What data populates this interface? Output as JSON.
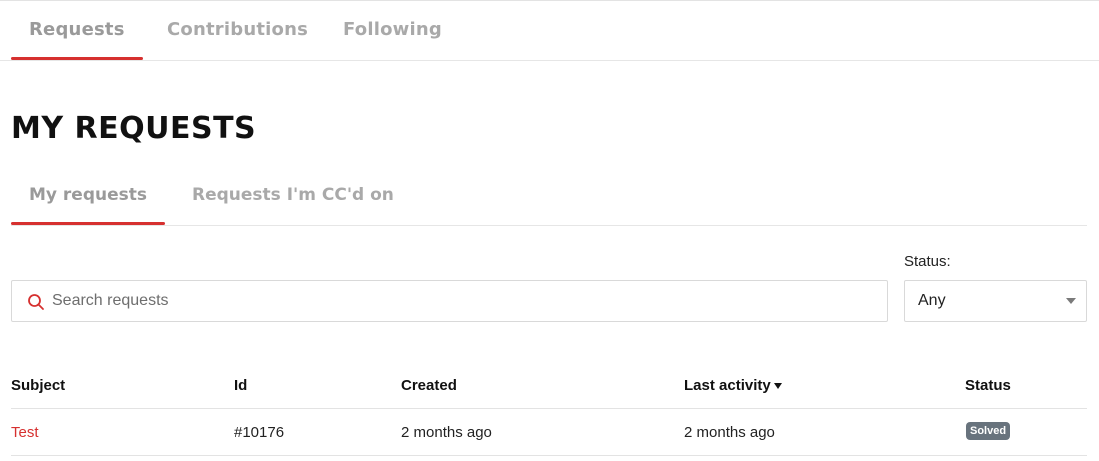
{
  "top_tabs": [
    {
      "label": "Requests",
      "active": true
    },
    {
      "label": "Contributions",
      "active": false
    },
    {
      "label": "Following",
      "active": false
    }
  ],
  "page_title": "MY REQUESTS",
  "sub_tabs": [
    {
      "label": "My requests",
      "active": true
    },
    {
      "label": "Requests I'm CC'd on",
      "active": false
    }
  ],
  "search": {
    "placeholder": "Search requests",
    "value": "",
    "icon": "search-icon"
  },
  "status_filter": {
    "label": "Status:",
    "selected": "Any"
  },
  "table": {
    "columns": [
      "Subject",
      "Id",
      "Created",
      "Last activity",
      "Status"
    ],
    "sorted_by": "Last activity",
    "rows": [
      {
        "subject": "Test",
        "id": "#10176",
        "created": "2 months ago",
        "last_activity": "2 months ago",
        "status": "Solved"
      }
    ]
  },
  "colors": {
    "accent": "#d6302f",
    "badge_solved": "#68737d",
    "tab_inactive": "#a9a9a9"
  }
}
